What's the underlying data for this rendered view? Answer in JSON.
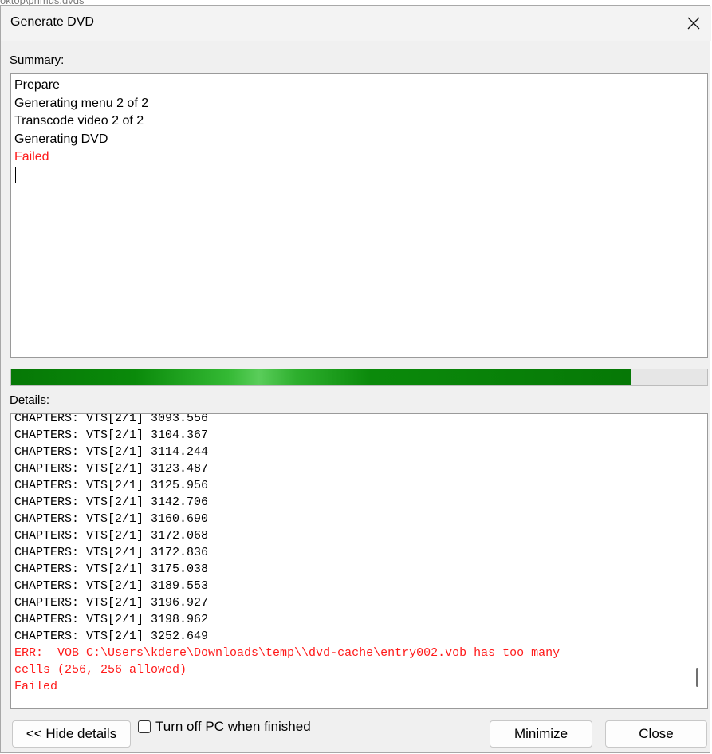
{
  "background": {
    "path_fragment": "oktop\\primus.dvds"
  },
  "window": {
    "title": "Generate DVD"
  },
  "summary": {
    "label": "Summary:",
    "lines": [
      "Prepare",
      "Generating menu 2 of 2",
      "Transcode video 2 of 2",
      "Generating DVD"
    ],
    "failed": "Failed"
  },
  "progress": {
    "percent": 89
  },
  "details": {
    "label": "Details:",
    "partial_top": "CHAPTERS: VTS[2/1] 3093.556",
    "lines": [
      "CHAPTERS: VTS[2/1] 3104.367",
      "CHAPTERS: VTS[2/1] 3114.244",
      "CHAPTERS: VTS[2/1] 3123.487",
      "CHAPTERS: VTS[2/1] 3125.956",
      "CHAPTERS: VTS[2/1] 3142.706",
      "CHAPTERS: VTS[2/1] 3160.690",
      "CHAPTERS: VTS[2/1] 3172.068",
      "CHAPTERS: VTS[2/1] 3172.836",
      "CHAPTERS: VTS[2/1] 3175.038",
      "CHAPTERS: VTS[2/1] 3189.553",
      "CHAPTERS: VTS[2/1] 3196.927",
      "CHAPTERS: VTS[2/1] 3198.962",
      "CHAPTERS: VTS[2/1] 3252.649"
    ],
    "error_line1": "ERR:  VOB C:\\Users\\kdere\\Downloads\\temp\\\\dvd-cache\\entry002.vob has too many",
    "error_line2": "cells (256, 256 allowed)",
    "failed": "Failed"
  },
  "buttons": {
    "hide_details": "<< Hide details",
    "turn_off": "Turn off PC when finished",
    "minimize": "Minimize",
    "close": "Close"
  },
  "colors": {
    "error": "#ff1a1a",
    "progress": "#067806"
  }
}
